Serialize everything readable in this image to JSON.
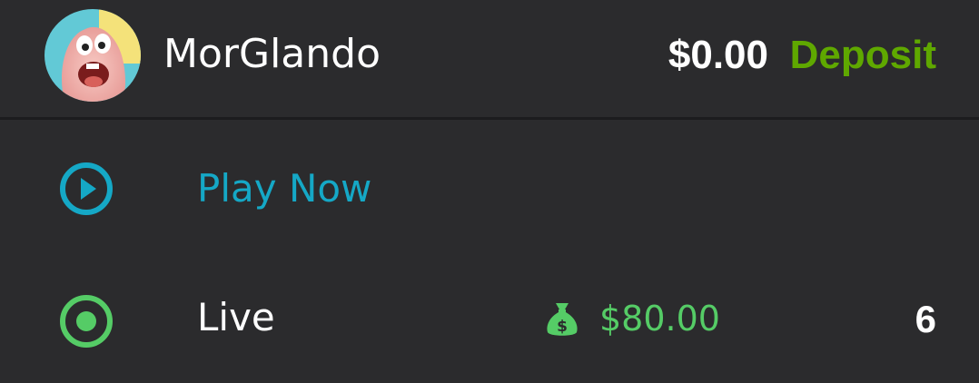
{
  "header": {
    "username": "MorGlando",
    "balance": "$0.00",
    "deposit_label": "Deposit",
    "avatar_icon": "profile-avatar"
  },
  "menu": {
    "play_now": {
      "label": "Play Now",
      "icon": "play-circle-icon",
      "color": "#15a8c6"
    },
    "live": {
      "label": "Live",
      "icon": "radio-target-icon",
      "icon_color": "#55cc66",
      "prize_icon": "money-bag-icon",
      "prize_amount": "$80.00",
      "count": "6"
    }
  },
  "colors": {
    "background": "#2b2b2d",
    "deposit": "#5fa800",
    "accent_blue": "#15a8c6",
    "accent_green": "#55cc66"
  }
}
